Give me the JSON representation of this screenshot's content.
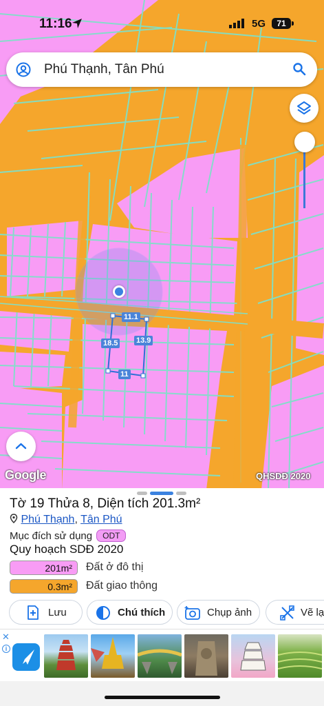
{
  "status_bar": {
    "time": "11:16",
    "network": "5G",
    "battery": "71"
  },
  "search": {
    "query": "Phú Thạnh, Tân Phú",
    "person_icon": "person-circle-icon",
    "search_icon": "search-icon"
  },
  "map": {
    "layer_button_icon": "layers-icon",
    "expand_icon": "chevron-up-icon",
    "attribution": "Google",
    "layer_name": "QHSDĐ 2020",
    "opacity_level": 1.0,
    "dimensions": {
      "top": "11.1",
      "left": "18.5",
      "right": "13.9",
      "bottom": "11"
    },
    "colors": {
      "residential": "#f89cf5",
      "transport": "#f5a62c",
      "parcel_line": "#7fe0c8",
      "location_dot": "#3b82e0"
    }
  },
  "sheet": {
    "title_prefix": "Tờ",
    "sheet_no": "19",
    "plot_word": "Thửa",
    "plot_no": "8",
    "area_text": ", Diện tích 201.3m²",
    "pin_icon": "map-pin-icon",
    "ward": "Phú Thạnh",
    "separator": ",",
    "district": "Tân Phú",
    "purpose_label": "Mục đích sử dụng",
    "purpose_code": "ODT",
    "plan_title": "Quy hoạch SDĐ 2020",
    "land_uses": [
      {
        "area": "201m²",
        "label": "Đất ở đô thị",
        "color": "#f89cf5"
      },
      {
        "area": "0.3m²",
        "label": "Đất giao thông",
        "color": "#f5a62c"
      }
    ]
  },
  "actions": [
    {
      "label": "Lưu",
      "icon": "add-document-icon"
    },
    {
      "label": "Chú thích",
      "icon": "half-circle-icon"
    },
    {
      "label": "Chụp ảnh",
      "icon": "camera-add-icon"
    },
    {
      "label": "Vẽ lạ",
      "icon": "draw-tools-icon"
    }
  ],
  "ad": {
    "close": "✕",
    "info": "i",
    "logo_icon": "bird-logo-icon",
    "thumbnail_count": 6
  }
}
